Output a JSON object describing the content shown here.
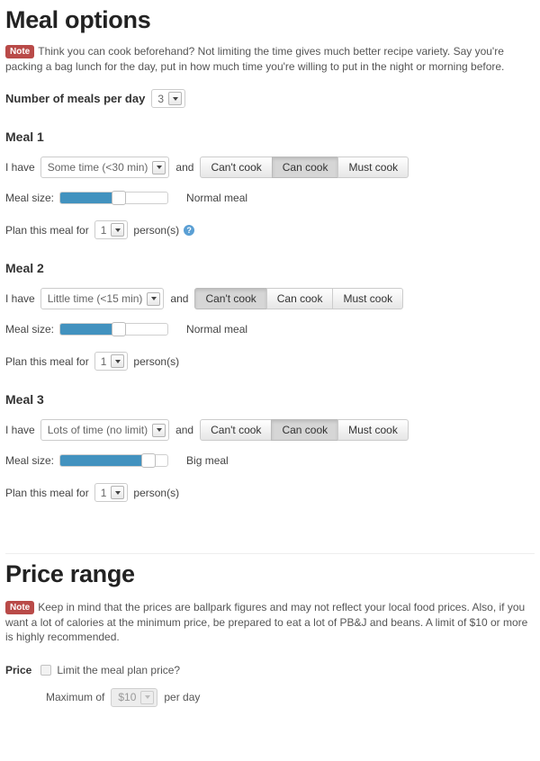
{
  "meal_options": {
    "title": "Meal options",
    "note": {
      "badge": "Note",
      "text": "Think you can cook beforehand? Not limiting the time gives much better recipe variety. Say you're packing a bag lunch for the day, put in how much time you're willing to put in the night or morning before."
    },
    "meals_per_day": {
      "label": "Number of meals per day",
      "value": "3"
    },
    "labels": {
      "i_have": "I have",
      "and": "and",
      "meal_size": "Meal size:",
      "plan_for": "Plan this meal for",
      "persons": "person(s)",
      "help_icon": "?"
    },
    "cook_options": [
      "Can't cook",
      "Can cook",
      "Must cook"
    ],
    "meals": [
      {
        "title": "Meal 1",
        "time_value": "Some time (<30 min)",
        "cook_selected": "Can cook",
        "size_percent": 55,
        "size_desc": "Normal meal",
        "persons": "1",
        "has_help": true
      },
      {
        "title": "Meal 2",
        "time_value": "Little time (<15 min)",
        "cook_selected": "Can't cook",
        "size_percent": 55,
        "size_desc": "Normal meal",
        "persons": "1",
        "has_help": false
      },
      {
        "title": "Meal 3",
        "time_value": "Lots of time (no limit)",
        "cook_selected": "Can cook",
        "size_percent": 82,
        "size_desc": "Big meal",
        "persons": "1",
        "has_help": false
      }
    ]
  },
  "price_range": {
    "title": "Price range",
    "note": {
      "badge": "Note",
      "text": "Keep in mind that the prices are ballpark figures and may not reflect your local food prices. Also, if you want a lot of calories at the minimum price, be prepared to eat a lot of PB&J and beans. A limit of $10 or more is highly recommended."
    },
    "price_label": "Price",
    "limit_checkbox_label": "Limit the meal plan price?",
    "limit_checked": false,
    "maximum_label": "Maximum of",
    "maximum_value": "$10",
    "per_day_label": "per day"
  },
  "colors": {
    "note_badge": "#b94a48",
    "slider_fill": "#4292bf",
    "help_icon": "#5a9fd4",
    "active_button": "#d6d6d6"
  }
}
